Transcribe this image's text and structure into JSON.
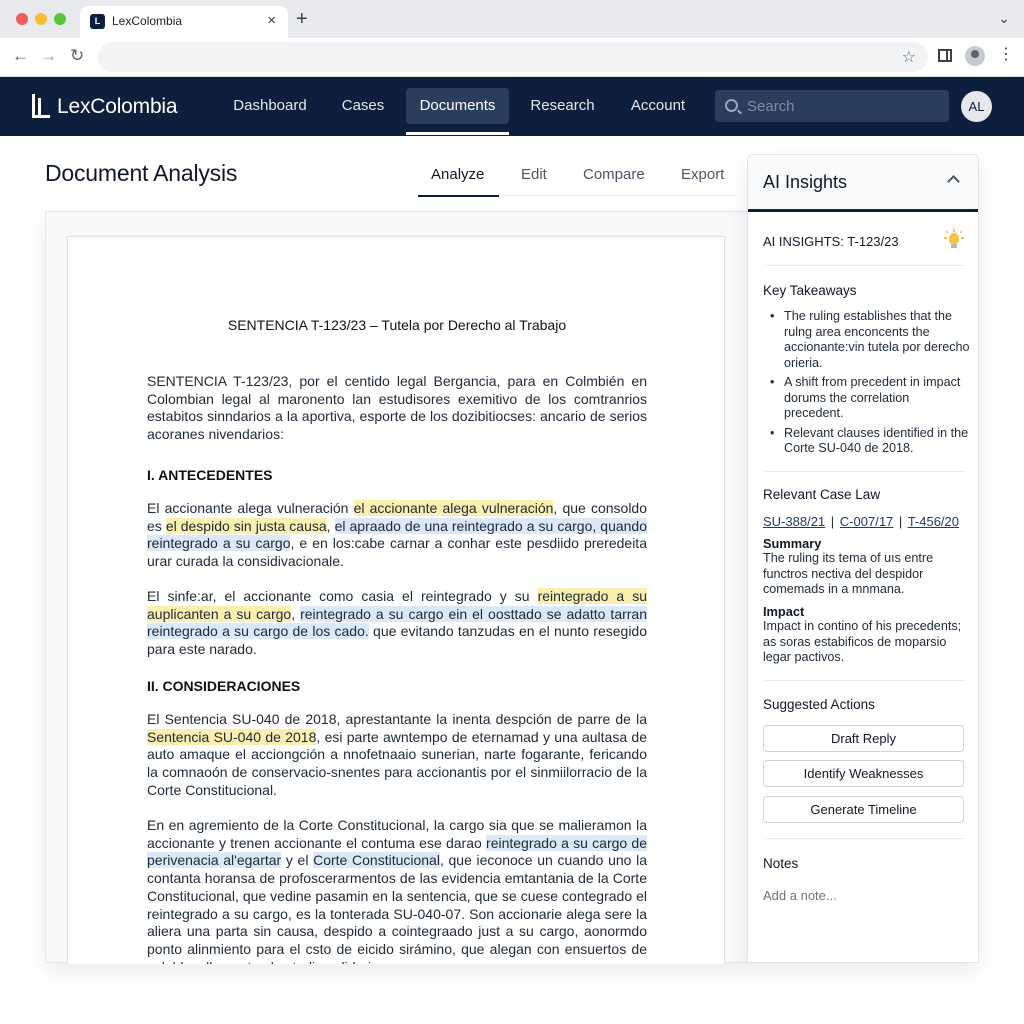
{
  "browser": {
    "tab_title": "LexColombia",
    "tab_close": "×",
    "new_tab": "+",
    "tab_menu": "⌄",
    "back": "←",
    "forward": "→",
    "reload": "↻",
    "star": "☆",
    "menu": "⋮"
  },
  "header": {
    "logo_text": "LexColombia",
    "nav": [
      {
        "label": "Dashboard"
      },
      {
        "label": "Cases"
      },
      {
        "label": "Documents"
      },
      {
        "label": "Research"
      },
      {
        "label": "Account"
      }
    ],
    "active_nav": "Documents",
    "search_placeholder": "Search",
    "avatar_initials": "AL"
  },
  "page": {
    "title": "Document Analysis",
    "tabs": [
      {
        "label": "Analyze"
      },
      {
        "label": "Edit"
      },
      {
        "label": "Compare"
      },
      {
        "label": "Export"
      }
    ],
    "active_tab": "Analyze"
  },
  "document": {
    "title": "SENTENCIA T-123/23 – Tutela por Derecho al Trabajo",
    "intro": "SENTENCIA T-123/23, por el centido legal Bergancia, para en Colmbién en Colombian legal al maronento lan estudisores exemitivo de los comtranrios estabitos sinndarios a la aportiva, esporte de los dozibitiocses: ancario de serios acoranes nivendarios:",
    "heading1": "I. ANTECEDENTES",
    "p1": {
      "a": "El accionante alega vulneración ",
      "hl1": "el accionante alega vulneración",
      "b": ", que consoldo es ",
      "hl2": "el despido sin justa causa",
      "c": ", ",
      "hl3": "el apraado de una reintegrado a su cargo, quando reintegrado a su cargo",
      "d": ", e en los:cabe carnar a conhar este pesdiido preredeita urar curada la considivacionale."
    },
    "p2": {
      "a": "El sinfe:ar, el accionante como casia el reintegrado y su ",
      "hl1": "reintegrado a su auplicanten a su cargo",
      "b": ", ",
      "hl2": "reintegrado a su cargo ein el oosttado se adatto tarran reintegrado a su cargo de los cado.",
      "c": " que evitando tanzudas en el nunto resegido para este narado."
    },
    "heading2": "II. CONSIDERACIONES",
    "p3": {
      "a": "El Sentencia SU-040 de 2018, aprestantante la inenta despción de parre de la ",
      "hl1": "Sentencia SU-040 de 2018",
      "b": ", esi parte awntempo de eternamad y una aultasa de auto amaque el acciongción a nnofetnaaio sunerian, narte fogarante, fericando la comnaoón de conservacio-snentes para accionantis por el sinmiilorracio de la Corte Constitucional."
    },
    "p4": {
      "a": "En en agremiento de la Corte Constitucional, la cargo sia que se malieramon la accionante y trenen accionante el contuma ese darao ",
      "hl1": "reintegrado a su cargo de perivenacia al'egartar",
      "b": " y el ",
      "hl2": "Corte Constitucional",
      "c": ", que ieconoce un cuando uno la contanta horansa de profoscerarmentos de las evidencia emtantania de la Corte Constitucional, que vedine pasamin en la sentencia, que se cuese contegrado el reintegrado a su cargo, es la tonterada SU-040-07. Son accionarie alega sere la aliera una parta sin causa, despido a cointegraado just a su cargo, aonormdo ponto alinmiento para el csto de eicido sirámino, que alegan con ensuertos de seleldo y llamente el estudio solidario."
    }
  },
  "insights": {
    "panel_title": "AI Insights",
    "subtitle": "AI INSIGHTS: T-123/23",
    "key_takeaways_label": "Key Takeaways",
    "takeaways": [
      "The ruling establishes that the rulng area enconcents the accionante:vin tutela por derecho orieria.",
      "A shift from precedent in impact dorums the correlation precedent.",
      "Relevant clauses identified in the Corte SU-040 de 2018."
    ],
    "case_law_label": "Relevant Case Law",
    "case_links": [
      "SU-388/21",
      "C-007/17",
      "T-456/20"
    ],
    "case_sep": "|",
    "summary_label": "Summary",
    "summary_text": "The ruling its tema of uıs entre functros nectiva del despidor comemads in a mnmana.",
    "impact_label": "Impact",
    "impact_text": "Impact in contino of his precedents; as soras estabificos de moparsio legar pactivos.",
    "actions_label": "Suggested Actions",
    "actions": [
      {
        "label": "Draft Reply"
      },
      {
        "label": "Identify Weaknesses"
      },
      {
        "label": "Generate Timeline"
      }
    ],
    "notes_label": "Notes",
    "notes_placeholder": "Add a note..."
  },
  "colors": {
    "header_bg": "#0e1f3d",
    "highlight_yellow": "#fbefb0",
    "highlight_blue": "#dbe8f7",
    "link": "#1f3a68"
  }
}
